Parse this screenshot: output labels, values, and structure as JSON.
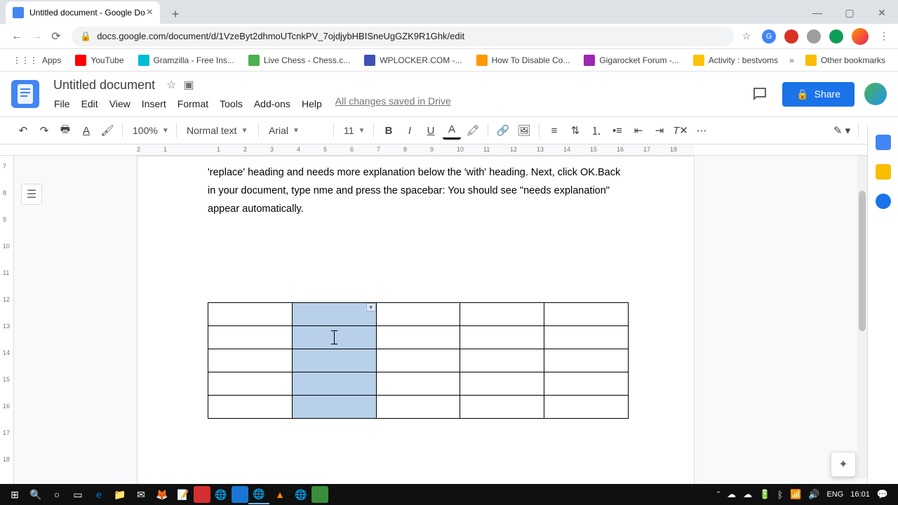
{
  "browser": {
    "tab_title": "Untitled document - Google Do",
    "url": "docs.google.com/document/d/1VzeByt2dhmoUTcnkPV_7ojdjybHBISneUgGZK9R1Ghk/edit"
  },
  "bookmarks": {
    "apps": "Apps",
    "items": [
      "YouTube",
      "Gramzilla - Free Ins...",
      "Live Chess - Chess.c...",
      "WPLOCKER.COM -...",
      "How To Disable Co...",
      "Gigarocket Forum -...",
      "Activity : bestvoms"
    ],
    "other": "Other bookmarks"
  },
  "docs": {
    "title": "Untitled document",
    "menus": [
      "File",
      "Edit",
      "View",
      "Insert",
      "Format",
      "Tools",
      "Add-ons",
      "Help"
    ],
    "save_status": "All changes saved in Drive",
    "share": "Share"
  },
  "toolbar": {
    "zoom": "100%",
    "style": "Normal text",
    "font": "Arial",
    "size": "11"
  },
  "body_text": "'replace' heading and needs more explanation below the 'with' heading. Next, click OK.Back in your document, type nme and press the spacebar: You should see \"needs  explanation\" appear automatically.",
  "ruler_ticks": [
    "2",
    "1",
    "",
    "1",
    "2",
    "3",
    "4",
    "5",
    "6",
    "7",
    "8",
    "9",
    "10",
    "11",
    "12",
    "13",
    "14",
    "15",
    "16",
    "17",
    "18"
  ],
  "vruler": [
    "7",
    "8",
    "9",
    "10",
    "11",
    "12",
    "13",
    "14",
    "15",
    "16",
    "17",
    "18"
  ],
  "tray": {
    "lang": "ENG",
    "time": "16:01"
  }
}
